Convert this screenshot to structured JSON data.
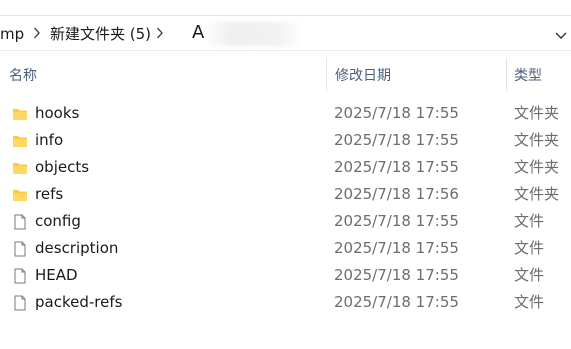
{
  "address_bar": {
    "crumbs": [
      "mp",
      "新建文件夹 (5)"
    ],
    "typed_text": "A"
  },
  "columns": {
    "name": "名称",
    "date_modified": "修改日期",
    "type": "类型"
  },
  "files": [
    {
      "name": "hooks",
      "date": "2025/7/18 17:55",
      "type": "文件夹",
      "icon": "folder-icon"
    },
    {
      "name": "info",
      "date": "2025/7/18 17:55",
      "type": "文件夹",
      "icon": "folder-icon"
    },
    {
      "name": "objects",
      "date": "2025/7/18 17:55",
      "type": "文件夹",
      "icon": "folder-icon"
    },
    {
      "name": "refs",
      "date": "2025/7/18 17:56",
      "type": "文件夹",
      "icon": "folder-icon"
    },
    {
      "name": "config",
      "date": "2025/7/18 17:55",
      "type": "文件",
      "icon": "file-icon"
    },
    {
      "name": "description",
      "date": "2025/7/18 17:55",
      "type": "文件",
      "icon": "file-icon"
    },
    {
      "name": "HEAD",
      "date": "2025/7/18 17:55",
      "type": "文件",
      "icon": "file-icon"
    },
    {
      "name": "packed-refs",
      "date": "2025/7/18 17:55",
      "type": "文件",
      "icon": "file-icon"
    }
  ],
  "colors": {
    "folder": "#ffc83d",
    "header_text": "#4c607a",
    "meta_text": "#6d6d6d"
  }
}
